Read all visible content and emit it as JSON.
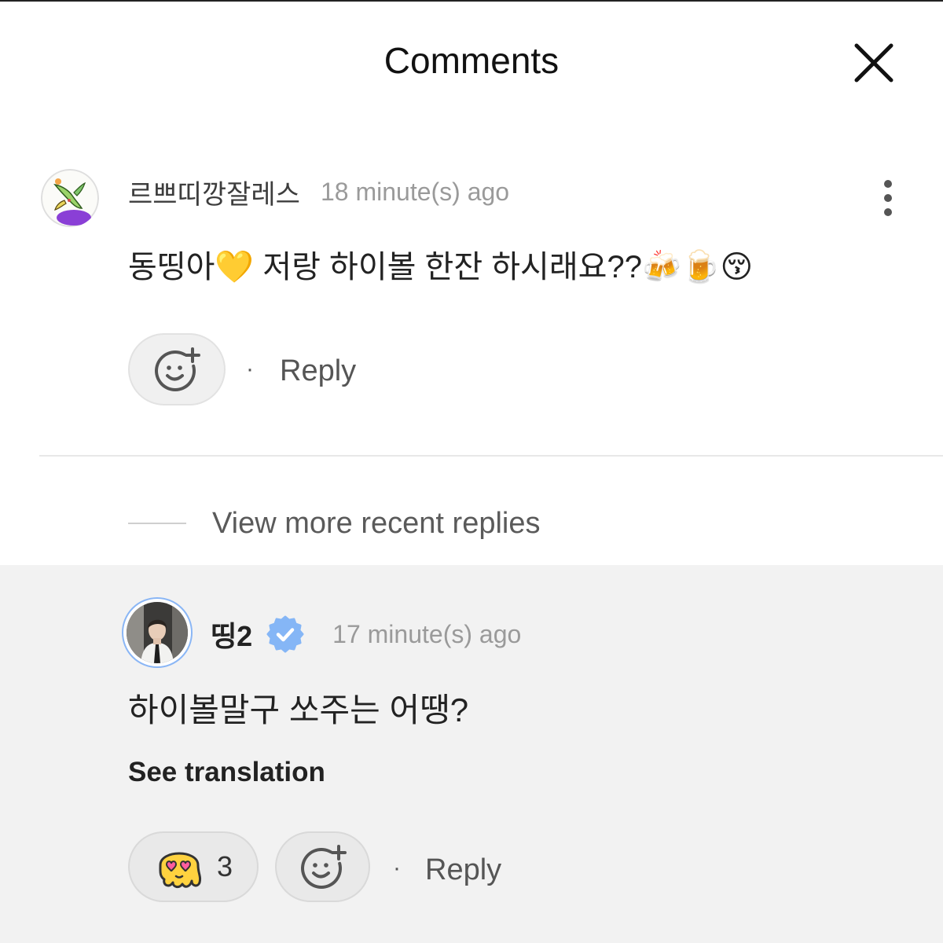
{
  "header": {
    "title": "Comments",
    "close_icon": "close-icon"
  },
  "comment": {
    "avatar_icon": "avatar-illustration",
    "username": "르쁘띠깡잘레스",
    "timestamp": "18 minute(s) ago",
    "menu_icon": "more-vertical-icon",
    "text": "동띵아💛 저랑 하이볼 한잔 하시래요??🍻🍺😚",
    "add_reaction_icon": "smile-plus-icon",
    "separator": "·",
    "reply_label": "Reply"
  },
  "thread": {
    "view_more_label": "View more recent replies"
  },
  "reply": {
    "avatar_icon": "avatar-photo",
    "username": "띵2",
    "verified": true,
    "verified_icon": "verified-badge-icon",
    "timestamp": "17 minute(s) ago",
    "text": "하이볼말구 쏘주는 어땡?",
    "see_translation_label": "See translation",
    "reaction": {
      "icon": "melting-face-heart-eyes-icon",
      "count": "3"
    },
    "add_reaction_icon": "smile-plus-icon",
    "separator": "·",
    "reply_label": "Reply"
  },
  "colors": {
    "background": "#ffffff",
    "reply_background": "#f2f2f2",
    "verified_badge": "#85b6f6",
    "text_primary": "#222222",
    "text_secondary": "#9a9a9a",
    "action_text": "#555555"
  }
}
